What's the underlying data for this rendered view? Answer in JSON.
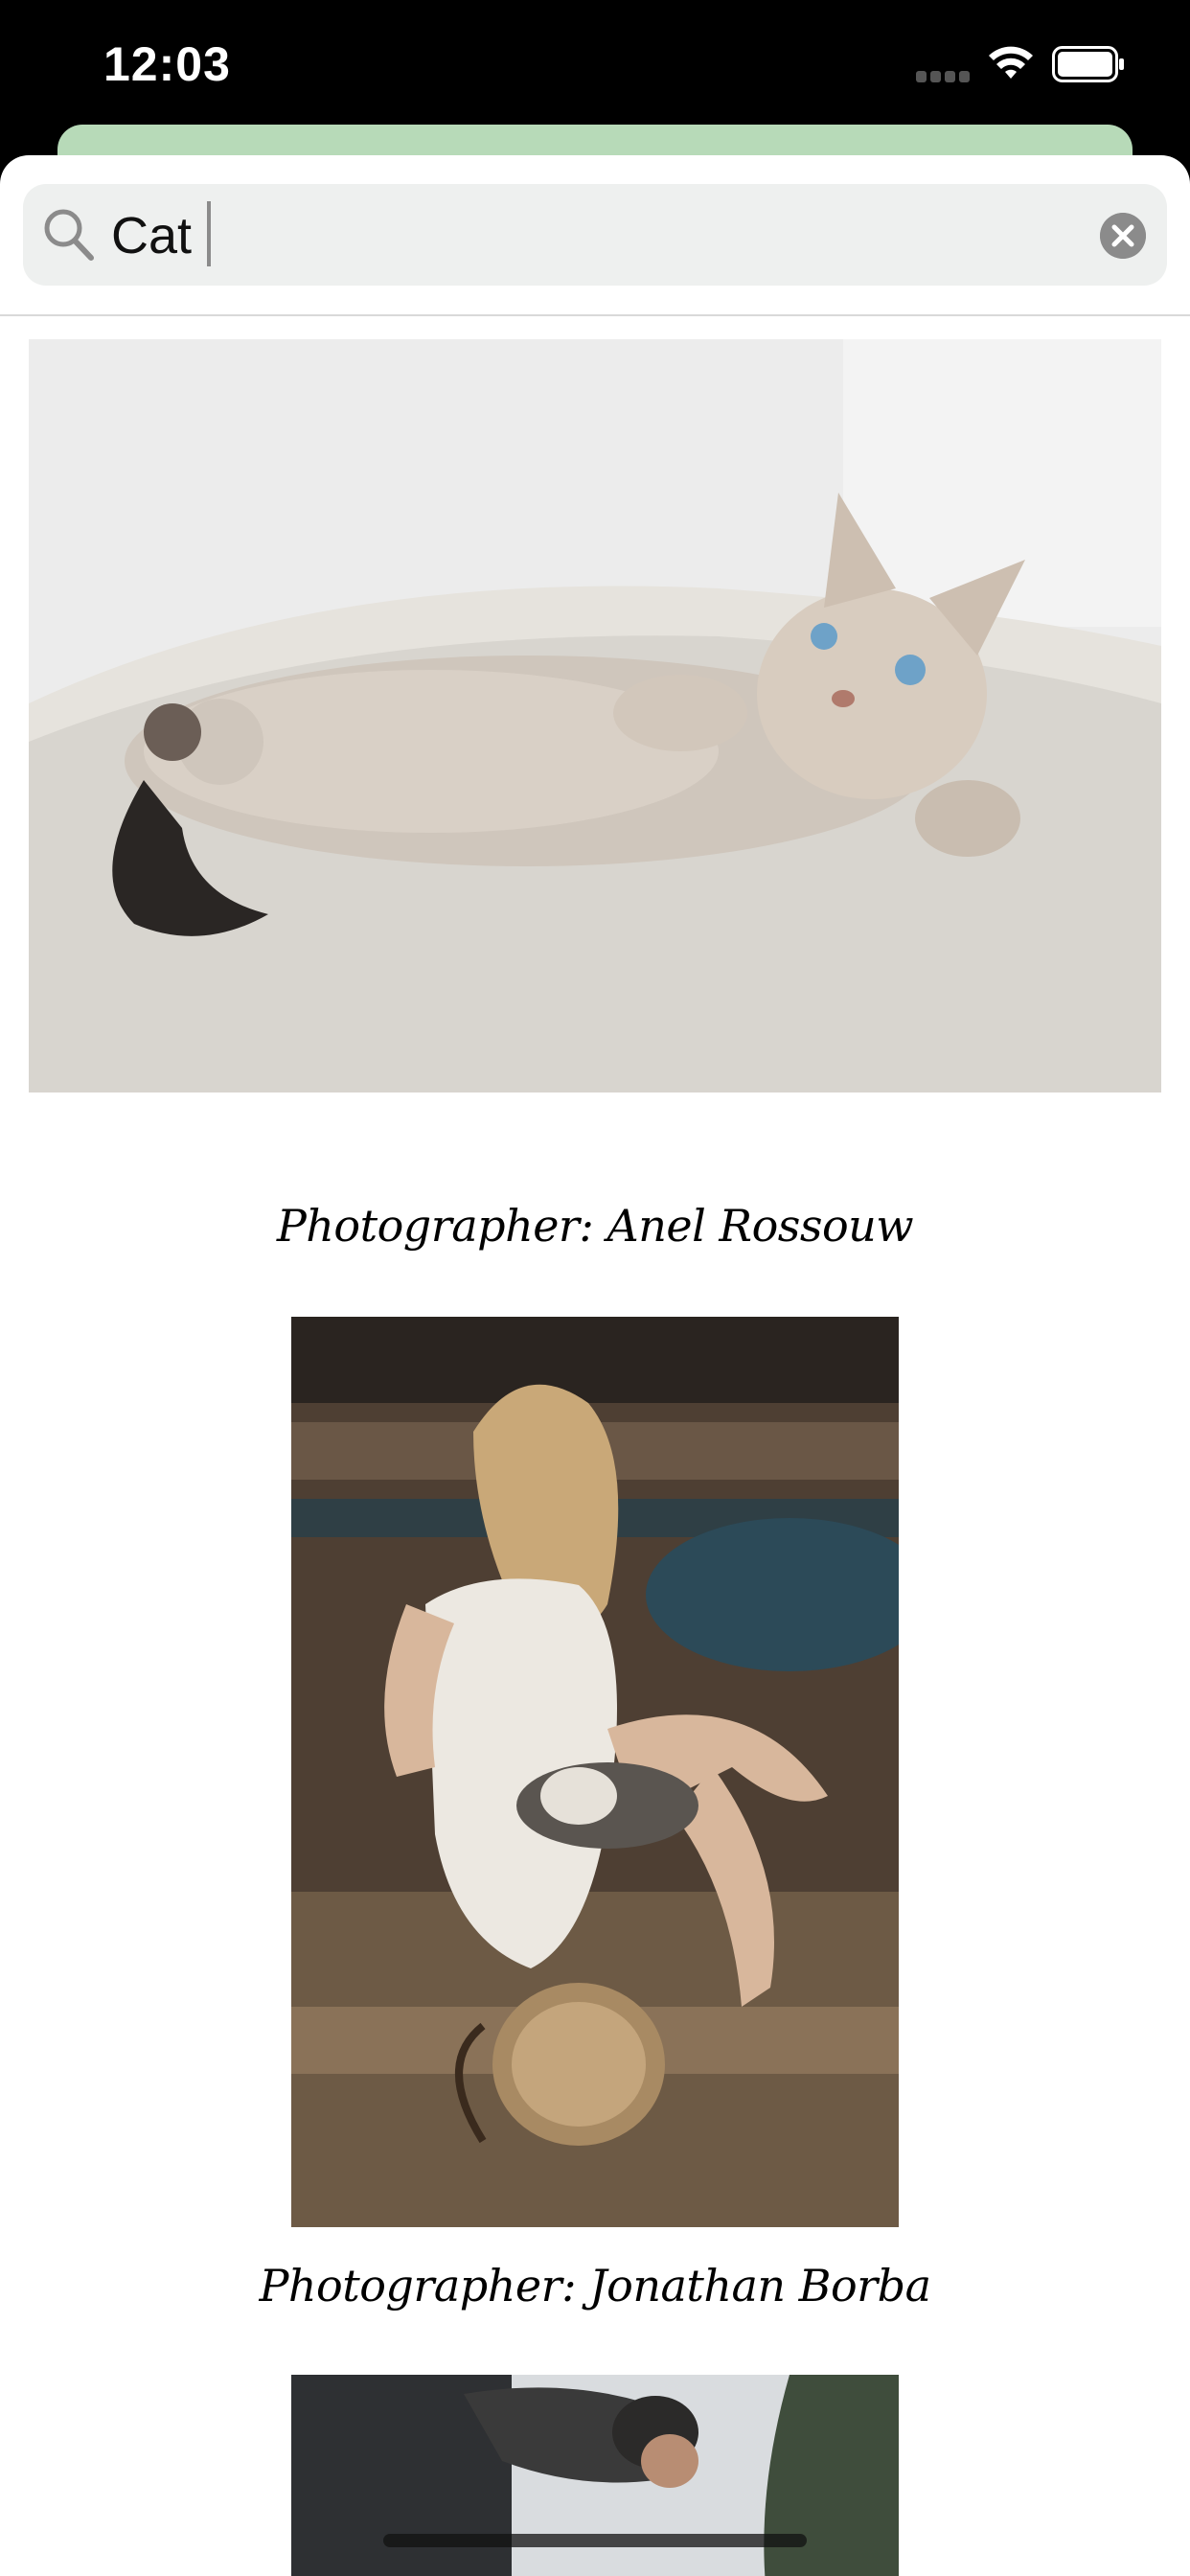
{
  "status_bar": {
    "time": "12:03"
  },
  "search": {
    "query": "Cat"
  },
  "results": [
    {
      "image": "cat-lying-on-blanket-photo",
      "caption": "Photographer: Anel Rossouw"
    },
    {
      "image": "woman-holding-cat-photo",
      "caption": "Photographer: Jonathan Borba"
    },
    {
      "image": "man-bending-photo",
      "caption": ""
    }
  ],
  "colors": {
    "status_bar_bg": "#000000",
    "back_card": "#b7dab8",
    "search_bg": "#eef0ef",
    "icon_gray": "#8b8b8b"
  },
  "icons": {
    "search": "search-icon",
    "clear": "clear-icon",
    "wifi": "wifi-icon",
    "battery": "battery-icon",
    "signal": "signal-icon"
  }
}
